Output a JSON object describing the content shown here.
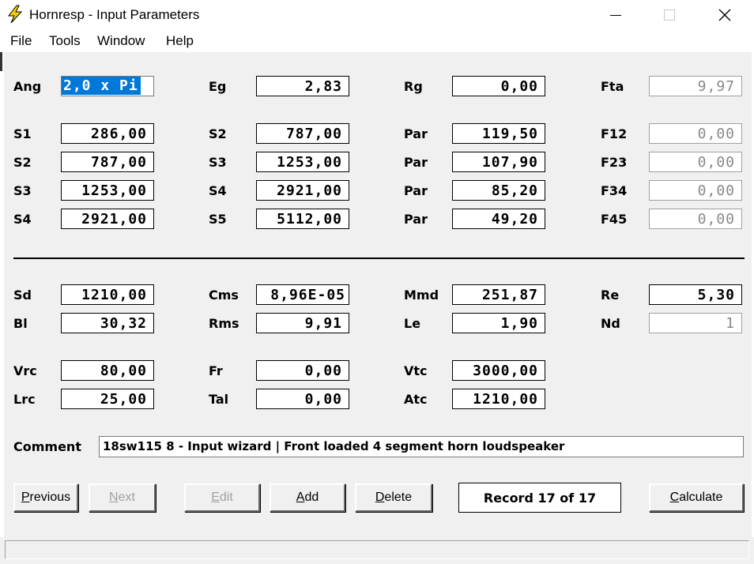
{
  "window": {
    "title": "Hornresp - Input Parameters",
    "minimize_glyph": "—",
    "maximize_glyph": "☐",
    "close_glyph": "✕"
  },
  "menu": [
    "File",
    "Tools",
    "Window",
    "Help"
  ],
  "top": {
    "ang": {
      "label": "Ang",
      "value": "2,0 x Pi"
    },
    "eg": {
      "label": "Eg",
      "value": "2,83"
    },
    "rg": {
      "label": "Rg",
      "value": "0,00"
    },
    "fta": {
      "label": "Fta",
      "value": "9,97"
    }
  },
  "segments": [
    {
      "sa_label": "S1",
      "sa": "286,00",
      "sb_label": "S2",
      "sb": "787,00",
      "par_label": "Par",
      "par": "119,50",
      "f_label": "F12",
      "f": "0,00"
    },
    {
      "sa_label": "S2",
      "sa": "787,00",
      "sb_label": "S3",
      "sb": "1253,00",
      "par_label": "Par",
      "par": "107,90",
      "f_label": "F23",
      "f": "0,00"
    },
    {
      "sa_label": "S3",
      "sa": "1253,00",
      "sb_label": "S4",
      "sb": "2921,00",
      "par_label": "Par",
      "par": "85,20",
      "f_label": "F34",
      "f": "0,00"
    },
    {
      "sa_label": "S4",
      "sa": "2921,00",
      "sb_label": "S5",
      "sb": "5112,00",
      "par_label": "Par",
      "par": "49,20",
      "f_label": "F45",
      "f": "0,00"
    }
  ],
  "driver": {
    "sd": {
      "label": "Sd",
      "value": "1210,00"
    },
    "cms": {
      "label": "Cms",
      "value": "8,96E-05"
    },
    "mmd": {
      "label": "Mmd",
      "value": "251,87"
    },
    "re": {
      "label": "Re",
      "value": "5,30"
    },
    "bl": {
      "label": "Bl",
      "value": "30,32"
    },
    "rms": {
      "label": "Rms",
      "value": "9,91"
    },
    "le": {
      "label": "Le",
      "value": "1,90"
    },
    "nd": {
      "label": "Nd",
      "value": "1"
    }
  },
  "chamber": {
    "vrc": {
      "label": "Vrc",
      "value": "80,00"
    },
    "fr": {
      "label": "Fr",
      "value": "0,00"
    },
    "vtc": {
      "label": "Vtc",
      "value": "3000,00"
    },
    "lrc": {
      "label": "Lrc",
      "value": "25,00"
    },
    "tal": {
      "label": "Tal",
      "value": "0,00"
    },
    "atc": {
      "label": "Atc",
      "value": "1210,00"
    }
  },
  "comment": {
    "label": "Comment",
    "value": "18sw115 8 - Input wizard | Front loaded 4 segment horn loudspeaker"
  },
  "buttons": {
    "previous": {
      "mnemonic": "P",
      "rest": "revious"
    },
    "next": {
      "mnemonic": "N",
      "rest": "ext"
    },
    "edit": {
      "mnemonic": "E",
      "rest": "dit"
    },
    "add": {
      "mnemonic": "A",
      "rest": "dd"
    },
    "delete": {
      "mnemonic": "D",
      "rest": "elete"
    },
    "calculate": {
      "mnemonic": "C",
      "rest": "alculate"
    }
  },
  "record": "Record 17 of 17",
  "colors": {
    "selection": "#0078d7",
    "dialog_bg": "#f0f0f0",
    "icon_yellow": "#f5d000"
  }
}
